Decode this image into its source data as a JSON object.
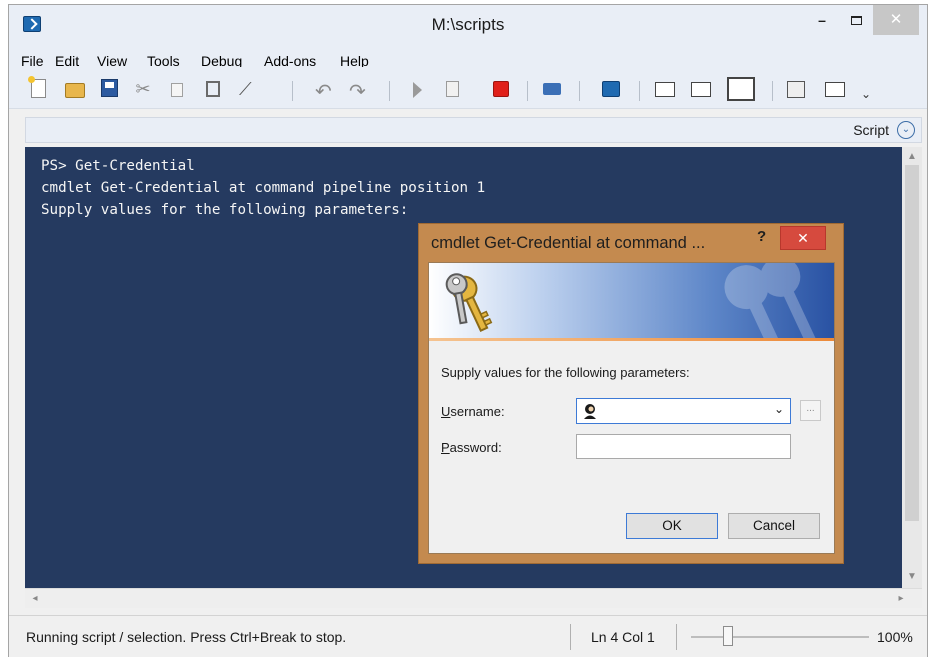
{
  "window": {
    "title": "M:\\scripts",
    "close_label": "✕"
  },
  "menubar": {
    "items": [
      "File",
      "Edit",
      "View",
      "Tools",
      "Debug",
      "Add-ons",
      "Help"
    ]
  },
  "toolbar": {
    "icons": [
      "new-file-icon",
      "open-folder-icon",
      "save-icon",
      "cut-icon",
      "copy-icon",
      "paste-icon",
      "clear-console-icon",
      "undo-icon",
      "redo-icon",
      "run-script-icon",
      "run-selection-icon",
      "stop-icon",
      "remote-powershell-icon",
      "powershell-icon",
      "show-script-top-icon",
      "show-script-right-icon",
      "show-script-maximized-icon",
      "show-command-addon-icon",
      "show-command-window-icon"
    ],
    "overflow_label": "⌄"
  },
  "script_bar": {
    "label": "Script",
    "toggle_glyph": "⌄"
  },
  "console": {
    "lines": [
      "PS> Get-Credential",
      "cmdlet Get-Credential at command pipeline position 1",
      "Supply values for the following parameters:"
    ],
    "background": "#253a60"
  },
  "dialog": {
    "title": "cmdlet Get-Credential at command ...",
    "help_label": "?",
    "close_label": "✕",
    "prompt": "Supply values for the following parameters:",
    "username_label_first": "U",
    "username_label_rest": "sername:",
    "username_value": "",
    "password_label_first": "P",
    "password_label_rest": "assword:",
    "password_value": "",
    "browse_label": "...",
    "ok_label": "OK",
    "cancel_label": "Cancel",
    "accent": "#c48a4f"
  },
  "statusbar": {
    "message": "Running script / selection.  Press Ctrl+Break to stop.",
    "position": "Ln 4  Col 1",
    "zoom": "100%",
    "zoom_slider_fraction": 0.2
  }
}
